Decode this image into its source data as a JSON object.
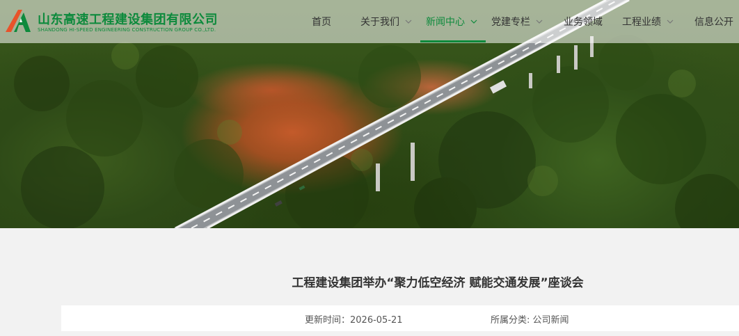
{
  "brand": {
    "name_cn": "山东高速工程建设集团有限公司",
    "name_en": "SHANDONG HI-SPEED ENGINEERING CONSTRUCTION GROUP CO.,LTD.",
    "primary_color": "#0d8a3c",
    "accent_color": "#e8532b"
  },
  "nav": {
    "items": [
      {
        "label": "首页",
        "has_dropdown": false,
        "active": false
      },
      {
        "label": "关于我们",
        "has_dropdown": true,
        "active": false
      },
      {
        "label": "新闻中心",
        "has_dropdown": true,
        "active": true
      },
      {
        "label": "党建专栏",
        "has_dropdown": true,
        "active": false
      },
      {
        "label": "业务领域",
        "has_dropdown": false,
        "active": false
      },
      {
        "label": "工程业绩",
        "has_dropdown": true,
        "active": false
      },
      {
        "label": "信息公开",
        "has_dropdown": false,
        "active": false
      }
    ]
  },
  "banner": {
    "image": "aerial-highway-bridge-forest"
  },
  "article": {
    "title": "工程建设集团举办“聚力低空经济 赋能交通发展”座谈会",
    "updated_label": "更新时间：",
    "updated_value": "2026-05-21",
    "category_label": "所属分类:",
    "category_value": "公司新闻"
  }
}
